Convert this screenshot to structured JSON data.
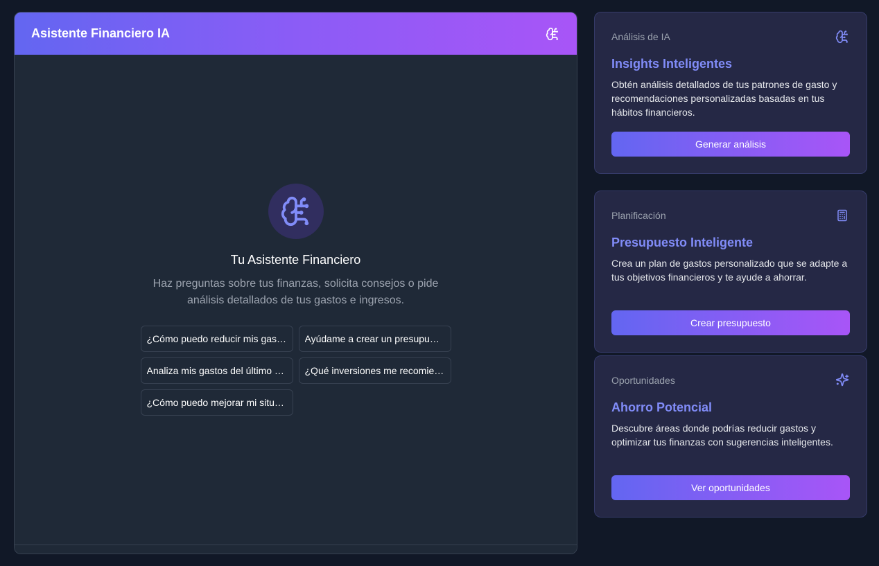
{
  "chat": {
    "title": "Asistente Financiero IA",
    "header_icon": "brain-circuit-icon",
    "welcome": {
      "icon": "brain-circuit-icon",
      "title": "Tu Asistente Financiero",
      "subtitle": "Haz preguntas sobre tus finanzas, solicita consejos o pide análisis detallados de tus gastos e ingresos."
    },
    "suggestions": [
      "¿Cómo puedo reducir mis gastos mensuales?",
      "Ayúdame a crear un presupuesto",
      "Analiza mis gastos del último mes",
      "¿Qué inversiones me recomiendas?",
      "¿Cómo puedo mejorar mi situación financiera?"
    ]
  },
  "cards": [
    {
      "category": "Análisis de IA",
      "icon": "brain-circuit-icon",
      "title": "Insights Inteligentes",
      "description": "Obtén análisis detallados de tus patrones de gasto y recomendaciones personalizadas basadas en tus hábitos financieros.",
      "button": "Generar análisis"
    },
    {
      "category": "Planificación",
      "icon": "calculator-icon",
      "title": "Presupuesto Inteligente",
      "description": "Crea un plan de gastos personalizado que se adapte a tus objetivos financieros y te ayude a ahorrar.",
      "button": "Crear presupuesto"
    },
    {
      "category": "Oportunidades",
      "icon": "sparkles-icon",
      "title": "Ahorro Potencial",
      "description": "Descubre áreas donde podrías reducir gastos y optimizar tus finanzas con sugerencias inteligentes.",
      "button": "Ver oportunidades"
    }
  ],
  "colors": {
    "background": "#111827",
    "panel": "#1f2937",
    "card": "#252845",
    "accent": "#818cf8",
    "gradient_start": "#6366f1",
    "gradient_end": "#a855f7"
  }
}
